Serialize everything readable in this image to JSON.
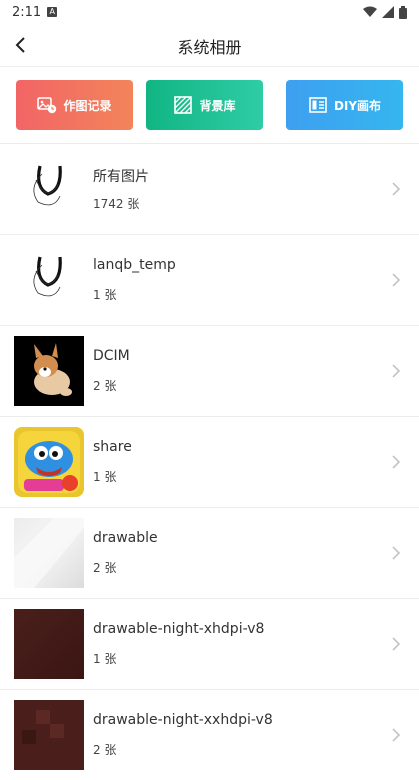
{
  "status": {
    "time": "2:11",
    "notif": "A"
  },
  "header": {
    "title": "系统相册"
  },
  "actions": [
    {
      "label": "作图记录"
    },
    {
      "label": "背景库"
    },
    {
      "label": "DIY画布"
    }
  ],
  "albums": [
    {
      "name": "所有图片",
      "count": "1742 张",
      "thumb": "scribble"
    },
    {
      "name": "lanqb_temp",
      "count": "1 张",
      "thumb": "scribble"
    },
    {
      "name": "DCIM",
      "count": "2 张",
      "thumb": "dog-photo"
    },
    {
      "name": "share",
      "count": "1 张",
      "thumb": "game-icon"
    },
    {
      "name": "drawable",
      "count": "2 张",
      "thumb": "light-gray"
    },
    {
      "name": "drawable-night-xhdpi-v8",
      "count": "1 张",
      "thumb": "dark-brown"
    },
    {
      "name": "drawable-night-xxhdpi-v8",
      "count": "2 张",
      "thumb": "dark-brown"
    }
  ],
  "colors": {
    "btn1": "#f26566",
    "btn2": "#11b583",
    "btn3": "#3e9ff0",
    "divider": "#ececec",
    "chevron": "#c4c4c4"
  }
}
